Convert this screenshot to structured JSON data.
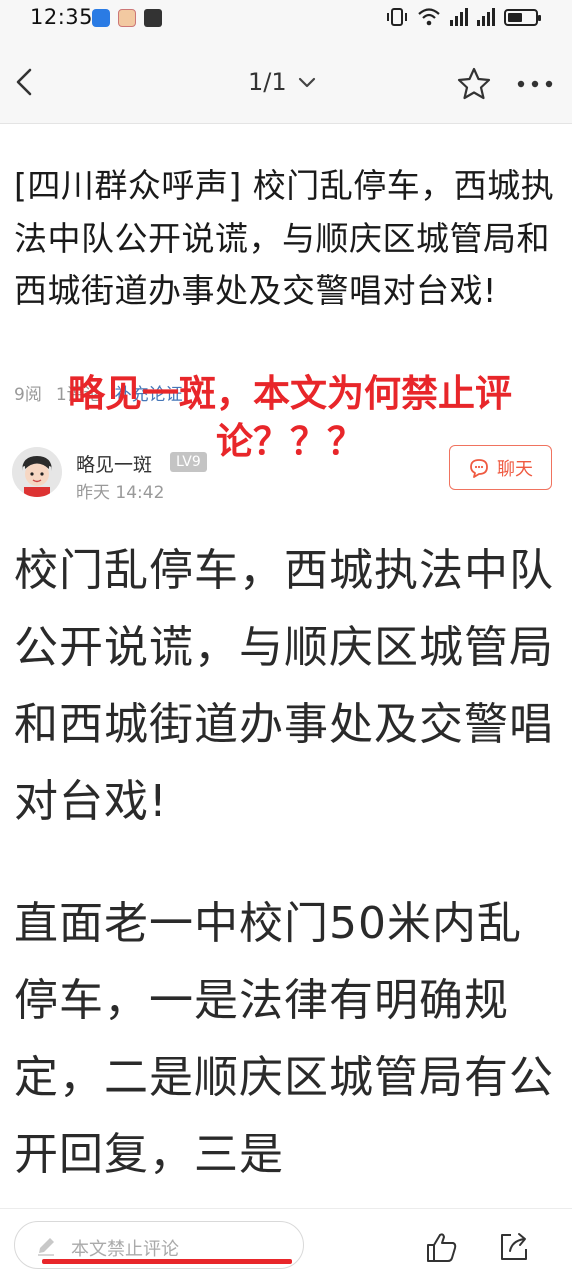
{
  "status_bar": {
    "time": "12:35",
    "icons": [
      "app-notification-icon",
      "app-icon",
      "app-icon",
      "vibrate-icon",
      "wifi-icon",
      "signal-icon",
      "signal-icon",
      "battery-icon"
    ],
    "battery_level": 0.55
  },
  "nav": {
    "counter": "1/1",
    "icons": [
      "back-icon",
      "chevron-down-icon",
      "star-icon",
      "more-icon"
    ]
  },
  "article": {
    "title": "[四川群众呼声] 校门乱停车，西城执法中队公开说谎，与顺庆区城管局和西城街道办事处及交警唱对台戏!",
    "meta": {
      "views": "9阅",
      "comments": "1评论",
      "supplement": "补充论证"
    },
    "overlay_annotation": "略见一斑，本文为何禁止评论？？？",
    "author": {
      "name": "略见一斑",
      "level": "LV9",
      "time": "昨天 14:42"
    },
    "chat_label": "聊天",
    "paragraphs": [
      "校门乱停车，西城执法中队公开说谎，与顺庆区城管局和西城街道办事处及交警唱对台戏!",
      "直面老一中校门50米内乱停车，一是法律有明确规定，二是顺庆区城管局有公开回复，三是"
    ]
  },
  "bottom_bar": {
    "comment_placeholder": "本文禁止评论",
    "icons": [
      "pencil-icon",
      "thumbs-up-icon",
      "share-icon"
    ]
  },
  "colors": {
    "accent_red": "#e8262a",
    "chat_orange": "#ef5a41",
    "link_blue": "#4677b8"
  }
}
